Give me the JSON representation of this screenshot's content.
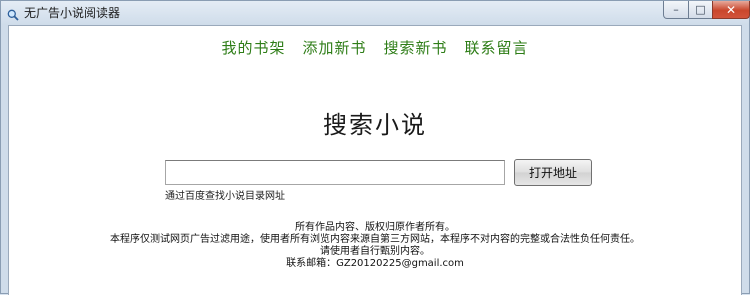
{
  "window": {
    "title": "无广告小说阅读器",
    "controls": {
      "minimize": "–",
      "maximize": "□",
      "close": "✕"
    }
  },
  "nav": {
    "items": [
      "我的书架",
      "添加新书",
      "搜索新书",
      "联系留言"
    ]
  },
  "search": {
    "heading": "搜索小说",
    "input_value": "",
    "button_label": "打开地址",
    "hint": "通过百度查找小说目录网址"
  },
  "footer": {
    "lines": [
      "所有作品内容、版权归原作者所有。",
      "本程序仅测试网页广告过滤用途，使用者所有浏览内容来源自第三方网站，本程序不对内容的完整或合法性负任何责任。",
      "请使用者自行甄别内容。",
      "联系邮箱：GZ20120225@gmail.com"
    ]
  },
  "colors": {
    "nav_link": "#2e7d17",
    "close_button": "#c9462c"
  },
  "icons": {
    "app": "magnifier-icon"
  }
}
